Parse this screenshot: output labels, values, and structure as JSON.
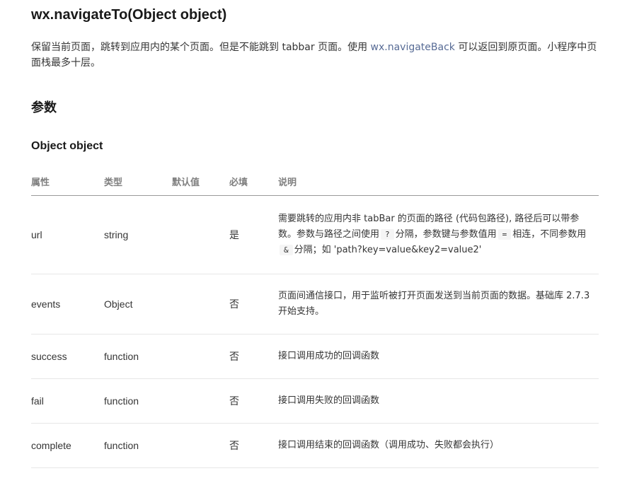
{
  "title": "wx.navigateTo(Object object)",
  "intro": {
    "before": "保留当前页面，跳转到应用内的某个页面。但是不能跳到 tabbar 页面。使用 ",
    "link": "wx.navigateBack",
    "after": " 可以返回到原页面。小程序中页面栈最多十层。"
  },
  "params_heading": "参数",
  "object_heading": "Object object",
  "table": {
    "headers": [
      "属性",
      "类型",
      "默认值",
      "必填",
      "说明"
    ],
    "rows": [
      {
        "name": "url",
        "type": "string",
        "default": "",
        "required": "是",
        "desc_parts": [
          "需要跳转的应用内非 tabBar 的页面的路径 (代码包路径), 路径后可以带参数。参数与路径之间使用",
          "?",
          "分隔，参数键与参数值用",
          "=",
          "相连，不同参数用",
          "&",
          "分隔；如 'path?key=value&key2=value2'"
        ]
      },
      {
        "name": "events",
        "type": "Object",
        "default": "",
        "required": "否",
        "desc": "页面间通信接口，用于监听被打开页面发送到当前页面的数据。基础库 2.7.3 开始支持。"
      },
      {
        "name": "success",
        "type": "function",
        "default": "",
        "required": "否",
        "desc": "接口调用成功的回调函数"
      },
      {
        "name": "fail",
        "type": "function",
        "default": "",
        "required": "否",
        "desc": "接口调用失败的回调函数"
      },
      {
        "name": "complete",
        "type": "function",
        "default": "",
        "required": "否",
        "desc": "接口调用结束的回调函数（调用成功、失败都会执行）"
      }
    ]
  },
  "colors": {
    "link": "#576b95",
    "text": "#353535",
    "header_text": "#7f7f7f",
    "code_bg": "#f5f5f5"
  }
}
